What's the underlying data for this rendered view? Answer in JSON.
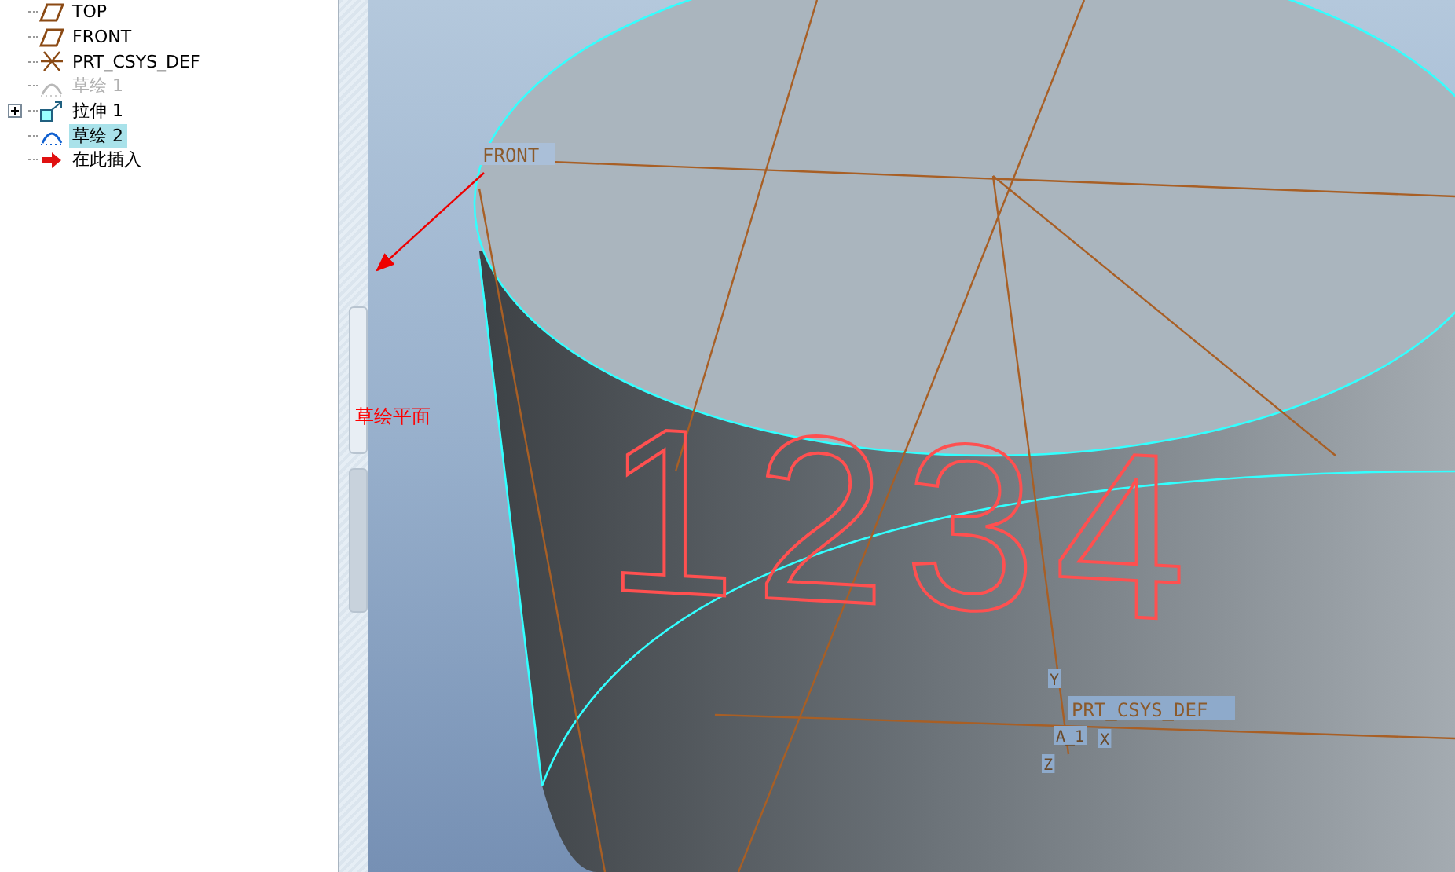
{
  "model_tree": {
    "items": [
      {
        "label": "TOP",
        "kind": "datum-plane",
        "selected": false,
        "disabled": false,
        "expandable": false
      },
      {
        "label": "FRONT",
        "kind": "datum-plane",
        "selected": false,
        "disabled": false,
        "expandable": false
      },
      {
        "label": "PRT_CSYS_DEF",
        "kind": "csys",
        "selected": false,
        "disabled": false,
        "expandable": false
      },
      {
        "label": "草绘 1",
        "kind": "sketch",
        "selected": false,
        "disabled": true,
        "expandable": false
      },
      {
        "label": "拉伸 1",
        "kind": "extrude",
        "selected": false,
        "disabled": false,
        "expandable": true
      },
      {
        "label": "草绘 2",
        "kind": "sketch",
        "selected": true,
        "disabled": false,
        "expandable": false
      },
      {
        "label": "在此插入",
        "kind": "insert",
        "selected": false,
        "disabled": false,
        "expandable": false
      }
    ]
  },
  "viewport": {
    "plane_label": "FRONT",
    "sketch_plane_label": "草绘平面",
    "sketch_text": "1234",
    "csys_label": "PRT_CSYS_DEF",
    "axis_labels": [
      "Y",
      "A_1",
      "X",
      "Z"
    ]
  }
}
